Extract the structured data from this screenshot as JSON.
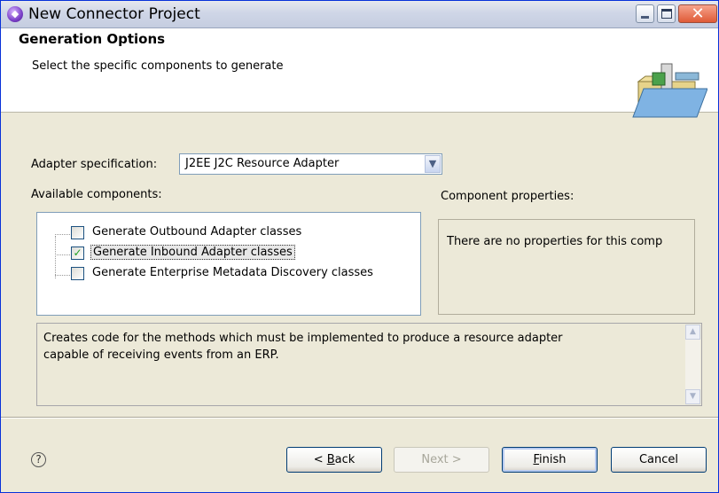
{
  "window": {
    "title": "New Connector Project",
    "controls": {
      "minimize": "minimize",
      "maximize": "maximize",
      "close": "close"
    }
  },
  "header": {
    "title": "Generation Options",
    "description": "Select the specific components to generate",
    "icon": "folder-connector-icon"
  },
  "adapter_spec": {
    "label": "Adapter specification:",
    "selected": "J2EE J2C Resource Adapter"
  },
  "components": {
    "label": "Available components:",
    "items": [
      {
        "label": "Generate Outbound Adapter classes",
        "checked": false
      },
      {
        "label": "Generate Inbound Adapter classes",
        "checked": true
      },
      {
        "label": "Generate Enterprise Metadata Discovery classes",
        "checked": false
      }
    ]
  },
  "properties": {
    "label": "Component properties:",
    "text": "There are no properties for this comp"
  },
  "description": {
    "line1": "Creates code for the methods which must be implemented to produce a resource adapter",
    "line2": "capable of receiving events from an ERP."
  },
  "buttons": {
    "help": "?",
    "back": {
      "pre": "< ",
      "mnemonic": "B",
      "post": "ack"
    },
    "next": "Next >",
    "finish": {
      "mnemonic": "F",
      "post": "inish"
    },
    "cancel": "Cancel"
  },
  "colors": {
    "title_bar": "#cfd6e7",
    "dialog_bg": "#ece9d8",
    "check": "#21a121"
  }
}
